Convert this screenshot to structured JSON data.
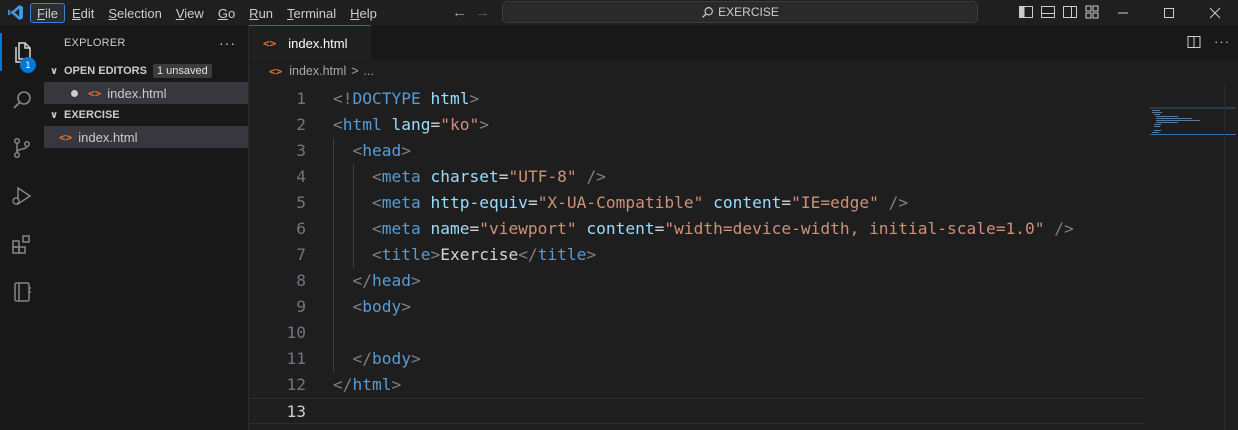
{
  "titlebar": {
    "menus": [
      {
        "label": "File",
        "active": true
      },
      {
        "label": "Edit"
      },
      {
        "label": "Selection"
      },
      {
        "label": "View"
      },
      {
        "label": "Go"
      },
      {
        "label": "Run"
      },
      {
        "label": "Terminal"
      },
      {
        "label": "Help"
      }
    ],
    "search_label": "EXERCISE",
    "accent": "#0078d4"
  },
  "activity": {
    "explorer_badge": "1"
  },
  "sidebar": {
    "title": "EXPLORER",
    "more": "···",
    "open_editors": {
      "label": "OPEN EDITORS",
      "badge": "1 unsaved",
      "item": "index.html"
    },
    "folder": {
      "label": "EXERCISE",
      "item": "index.html"
    }
  },
  "editor": {
    "tab": {
      "name": "index.html"
    },
    "breadcrumb": {
      "file": "index.html",
      "separator": ">",
      "more": "..."
    },
    "lines": [
      {
        "n": "1",
        "tokens": [
          [
            "br",
            "<!"
          ],
          [
            "tag",
            "DOCTYPE"
          ],
          [
            "txt",
            " "
          ],
          [
            "attr",
            "html"
          ],
          [
            "br",
            ">"
          ]
        ]
      },
      {
        "n": "2",
        "tokens": [
          [
            "br",
            "<"
          ],
          [
            "tag",
            "html"
          ],
          [
            "txt",
            " "
          ],
          [
            "attr",
            "lang"
          ],
          [
            "txt",
            "="
          ],
          [
            "str",
            "\"ko\""
          ],
          [
            "br",
            ">"
          ]
        ]
      },
      {
        "n": "3",
        "tokens": [
          [
            "txt",
            "  "
          ],
          [
            "br",
            "<"
          ],
          [
            "tag",
            "head"
          ],
          [
            "br",
            ">"
          ]
        ]
      },
      {
        "n": "4",
        "tokens": [
          [
            "txt",
            "    "
          ],
          [
            "br",
            "<"
          ],
          [
            "tag",
            "meta"
          ],
          [
            "txt",
            " "
          ],
          [
            "attr",
            "charset"
          ],
          [
            "txt",
            "="
          ],
          [
            "str",
            "\"UTF-8\""
          ],
          [
            "txt",
            " "
          ],
          [
            "br",
            "/>"
          ]
        ]
      },
      {
        "n": "5",
        "tokens": [
          [
            "txt",
            "    "
          ],
          [
            "br",
            "<"
          ],
          [
            "tag",
            "meta"
          ],
          [
            "txt",
            " "
          ],
          [
            "attr",
            "http-equiv"
          ],
          [
            "txt",
            "="
          ],
          [
            "str",
            "\"X-UA-Compatible\""
          ],
          [
            "txt",
            " "
          ],
          [
            "attr",
            "content"
          ],
          [
            "txt",
            "="
          ],
          [
            "str",
            "\"IE=edge\""
          ],
          [
            "txt",
            " "
          ],
          [
            "br",
            "/>"
          ]
        ]
      },
      {
        "n": "6",
        "tokens": [
          [
            "txt",
            "    "
          ],
          [
            "br",
            "<"
          ],
          [
            "tag",
            "meta"
          ],
          [
            "txt",
            " "
          ],
          [
            "attr",
            "name"
          ],
          [
            "txt",
            "="
          ],
          [
            "str",
            "\"viewport\""
          ],
          [
            "txt",
            " "
          ],
          [
            "attr",
            "content"
          ],
          [
            "txt",
            "="
          ],
          [
            "str",
            "\"width=device-width, initial-scale=1.0\""
          ],
          [
            "txt",
            " "
          ],
          [
            "br",
            "/>"
          ]
        ]
      },
      {
        "n": "7",
        "tokens": [
          [
            "txt",
            "    "
          ],
          [
            "br",
            "<"
          ],
          [
            "tag",
            "title"
          ],
          [
            "br",
            ">"
          ],
          [
            "txt",
            "Exercise"
          ],
          [
            "br",
            "</"
          ],
          [
            "tag",
            "title"
          ],
          [
            "br",
            ">"
          ]
        ]
      },
      {
        "n": "8",
        "tokens": [
          [
            "txt",
            "  "
          ],
          [
            "br",
            "</"
          ],
          [
            "tag",
            "head"
          ],
          [
            "br",
            ">"
          ]
        ]
      },
      {
        "n": "9",
        "tokens": [
          [
            "txt",
            "  "
          ],
          [
            "br",
            "<"
          ],
          [
            "tag",
            "body"
          ],
          [
            "br",
            ">"
          ]
        ]
      },
      {
        "n": "10",
        "tokens": []
      },
      {
        "n": "11",
        "tokens": [
          [
            "txt",
            "  "
          ],
          [
            "br",
            "</"
          ],
          [
            "tag",
            "body"
          ],
          [
            "br",
            ">"
          ]
        ]
      },
      {
        "n": "12",
        "tokens": [
          [
            "br",
            "</"
          ],
          [
            "tag",
            "html"
          ],
          [
            "br",
            ">"
          ]
        ]
      },
      {
        "n": "13",
        "tokens": [],
        "current": true
      }
    ]
  }
}
